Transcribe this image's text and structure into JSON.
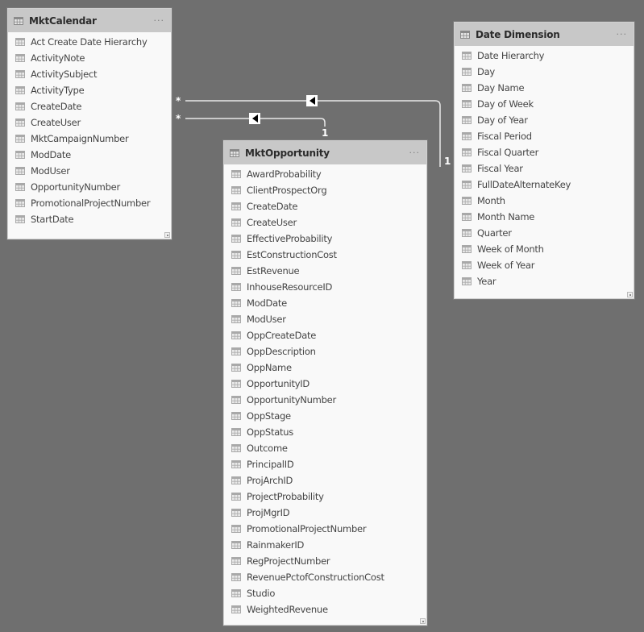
{
  "tables": {
    "mkt_calendar": {
      "title": "MktCalendar",
      "more": "···",
      "fields": [
        "Act Create Date Hierarchy",
        "ActivityNote",
        "ActivitySubject",
        "ActivityType",
        "CreateDate",
        "CreateUser",
        "MktCampaignNumber",
        "ModDate",
        "ModUser",
        "OpportunityNumber",
        "PromotionalProjectNumber",
        "StartDate"
      ]
    },
    "mkt_opportunity": {
      "title": "MktOpportunity",
      "more": "···",
      "fields": [
        "AwardProbability",
        "ClientProspectOrg",
        "CreateDate",
        "CreateUser",
        "EffectiveProbability",
        "EstConstructionCost",
        "EstRevenue",
        "InhouseResourceID",
        "ModDate",
        "ModUser",
        "OppCreateDate",
        "OppDescription",
        "OppName",
        "OpportunityID",
        "OpportunityNumber",
        "OppStage",
        "OppStatus",
        "Outcome",
        "PrincipalID",
        "ProjArchID",
        "ProjectProbability",
        "ProjMgrID",
        "PromotionalProjectNumber",
        "RainmakerID",
        "RegProjectNumber",
        "RevenuePctofConstructionCost",
        "Studio",
        "WeightedRevenue"
      ]
    },
    "date_dimension": {
      "title": "Date Dimension",
      "more": "···",
      "fields": [
        "Date Hierarchy",
        "Day",
        "Day Name",
        "Day of Week",
        "Day of Year",
        "Fiscal Period",
        "Fiscal Quarter",
        "Fiscal Year",
        "FullDateAlternateKey",
        "Month",
        "Month Name",
        "Quarter",
        "Week of Month",
        "Week of Year",
        "Year"
      ]
    }
  },
  "relationships": [
    {
      "from": "MktCalendar",
      "to": "Date Dimension",
      "from_cardinality": "*",
      "to_cardinality": "1",
      "filter_direction": "single"
    },
    {
      "from": "MktCalendar",
      "to": "MktOpportunity",
      "from_cardinality": "*",
      "to_cardinality": "1",
      "filter_direction": "single"
    }
  ],
  "colors": {
    "canvas": "#6f6f6f",
    "card_bg": "#f9f9f9",
    "header_bg": "#c8c8c8",
    "line": "#e6e6e6"
  }
}
